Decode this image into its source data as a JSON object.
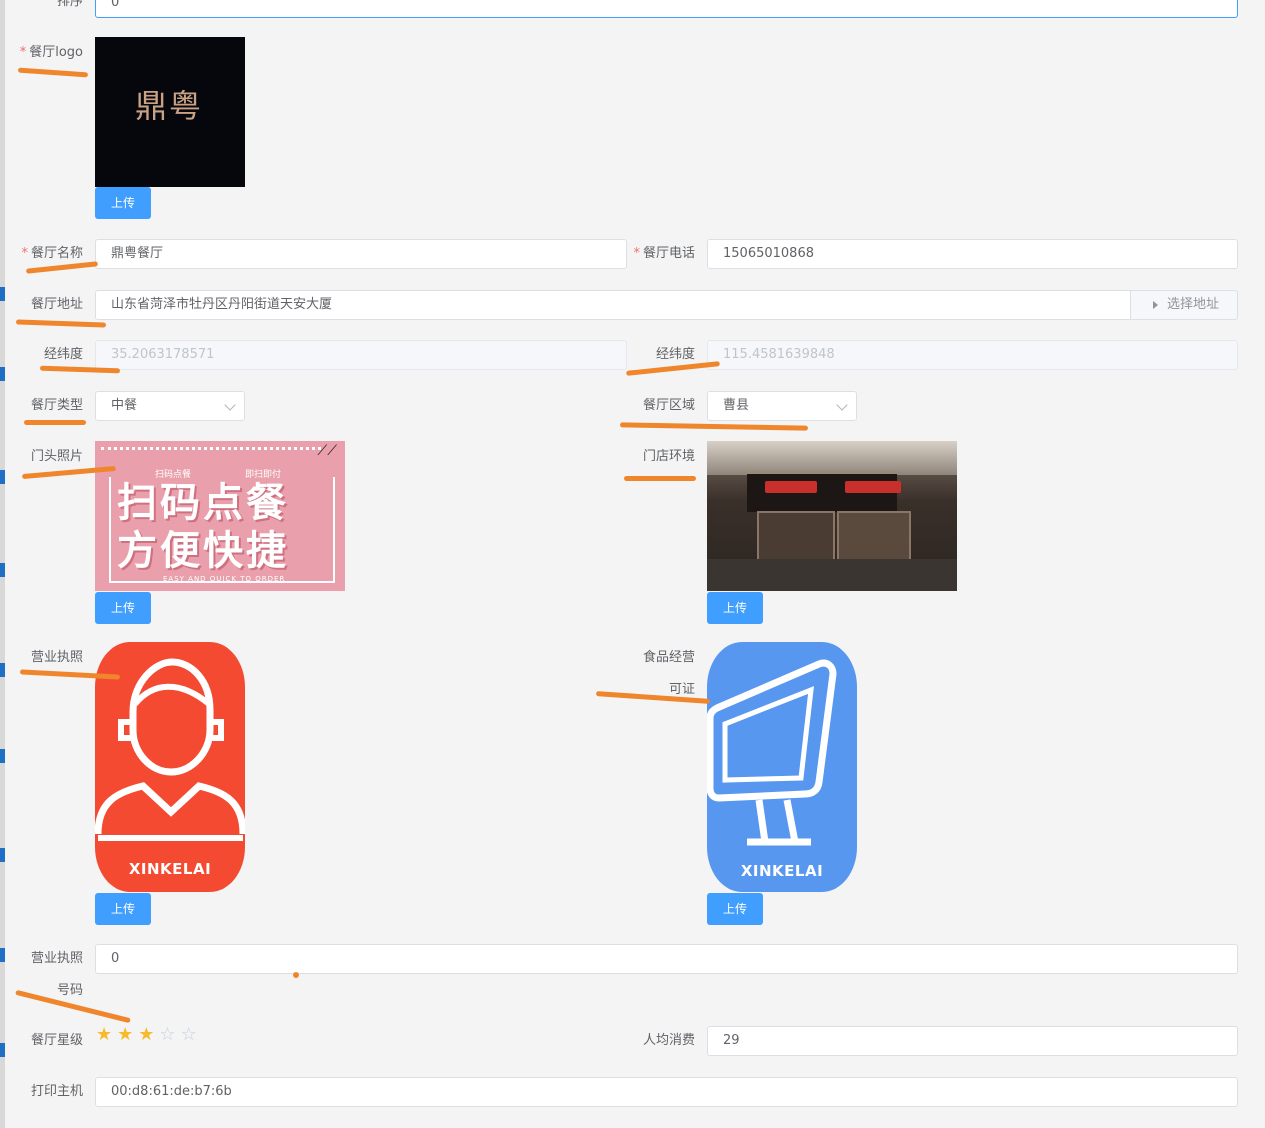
{
  "form": {
    "sort": {
      "label": "排序",
      "value": "0"
    },
    "logo": {
      "label": "餐厅logo",
      "upload": "上传"
    },
    "name": {
      "label": "餐厅名称",
      "value": "鼎粤餐厅"
    },
    "phone": {
      "label": "餐厅电话",
      "value": "15065010868"
    },
    "address": {
      "label": "餐厅地址",
      "value": "山东省菏泽市牡丹区丹阳街道天安大厦",
      "select_label": "选择地址"
    },
    "coord_lat": {
      "label": "经纬度",
      "value": "35.2063178571"
    },
    "coord_lng": {
      "label": "经纬度",
      "value": "115.4581639848"
    },
    "type": {
      "label": "餐厅类型",
      "value": "中餐"
    },
    "region": {
      "label": "餐厅区域",
      "value": "曹县"
    },
    "storefront": {
      "label": "门头照片",
      "upload": "上传"
    },
    "environment": {
      "label": "门店环境",
      "upload": "上传"
    },
    "license": {
      "label": "营业执照",
      "upload": "上传"
    },
    "food_license": {
      "label_line1": "食品经营",
      "label_line2": "可证",
      "upload": "上传"
    },
    "license_number": {
      "label_line1": "营业执照",
      "label_line2": "号码",
      "value": "0"
    },
    "rating": {
      "label": "餐厅星级",
      "value": 3,
      "max": 5
    },
    "per_capita": {
      "label": "人均消费",
      "value": "29"
    },
    "printer": {
      "label": "打印主机",
      "value": "00:d8:61:de:b7:6b"
    }
  },
  "images": {
    "logo_text": "鼎粤",
    "storefront_line1": "扫码点餐",
    "storefront_line2": "方便快捷",
    "storefront_small_left": "扫码点餐",
    "storefront_small_right": "即扫即付",
    "storefront_bottom": "EASY AND QUICK TO ORDER",
    "brand": "XINKELAI"
  },
  "colors": {
    "primary": "#409eff",
    "required": "#f56c6c",
    "annotation": "#f0862c",
    "star": "#f7ba2a",
    "license_bg": "#f44a32",
    "food_bg": "#5797f0"
  }
}
